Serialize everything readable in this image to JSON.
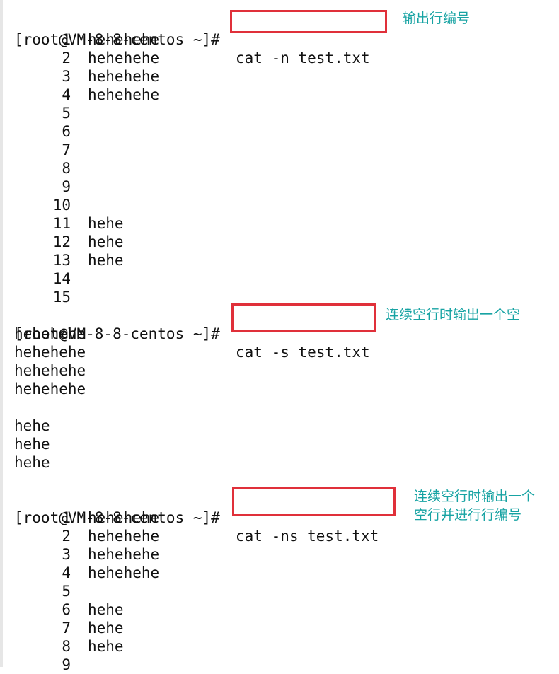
{
  "colors": {
    "annotation_box": "#e0303a",
    "annotation_text": "#17a3a3"
  },
  "prompt": "[root@VM-8-8-centos ~]#",
  "blocks": [
    {
      "command": "cat -n test.txt",
      "note": "输出行编号",
      "output": [
        {
          "n": "1",
          "t": "hehehehe"
        },
        {
          "n": "2",
          "t": "hehehehe"
        },
        {
          "n": "3",
          "t": "hehehehe"
        },
        {
          "n": "4",
          "t": "hehehehe"
        },
        {
          "n": "5",
          "t": ""
        },
        {
          "n": "6",
          "t": ""
        },
        {
          "n": "7",
          "t": ""
        },
        {
          "n": "8",
          "t": ""
        },
        {
          "n": "9",
          "t": ""
        },
        {
          "n": "10",
          "t": ""
        },
        {
          "n": "11",
          "t": "hehe"
        },
        {
          "n": "12",
          "t": "hehe"
        },
        {
          "n": "13",
          "t": "hehe"
        },
        {
          "n": "14",
          "t": ""
        },
        {
          "n": "15",
          "t": ""
        }
      ]
    },
    {
      "command": "cat -s test.txt",
      "note": "连续空行时输出一个空",
      "output": [
        "hehehehe",
        "hehehehe",
        "hehehehe",
        "hehehehe",
        "",
        "hehe",
        "hehe",
        "hehe",
        ""
      ]
    },
    {
      "command": "cat -ns test.txt",
      "note": "连续空行时输出一个\n空行并进行行编号",
      "output": [
        {
          "n": "1",
          "t": "hehehehe"
        },
        {
          "n": "2",
          "t": "hehehehe"
        },
        {
          "n": "3",
          "t": "hehehehe"
        },
        {
          "n": "4",
          "t": "hehehehe"
        },
        {
          "n": "5",
          "t": ""
        },
        {
          "n": "6",
          "t": "hehe"
        },
        {
          "n": "7",
          "t": "hehe"
        },
        {
          "n": "8",
          "t": "hehe"
        },
        {
          "n": "9",
          "t": ""
        }
      ]
    }
  ]
}
